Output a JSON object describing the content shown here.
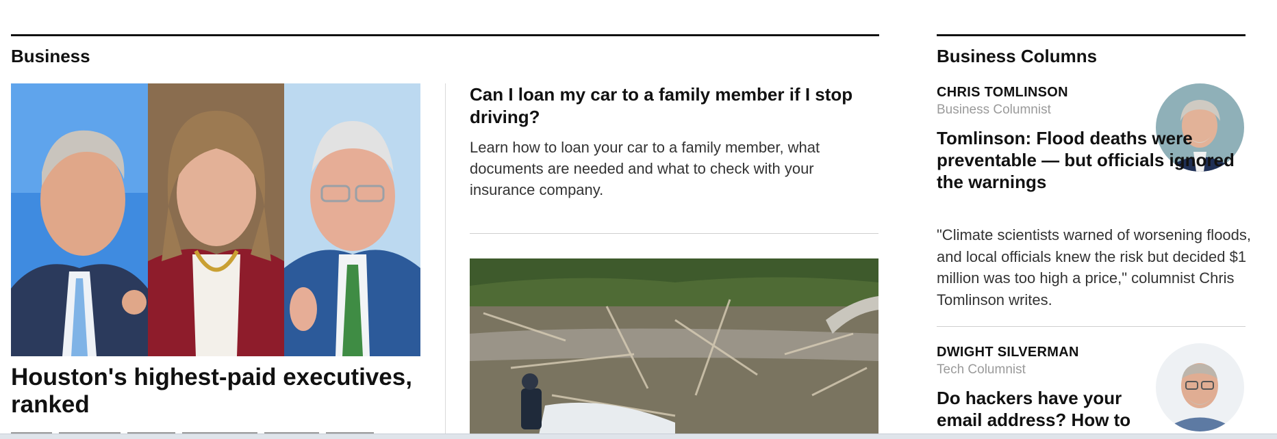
{
  "business": {
    "section_label": "Business",
    "lead_story": {
      "title": "Houston's highest-paid executives, ranked",
      "image_icon": "executive-portraits-photo"
    },
    "side_story": {
      "title": "Can I loan my car to a family member if I stop driving?",
      "dek": "Learn how to loan your car to a family member, what documents are needed and what to check with your insurance company."
    },
    "second_story": {
      "image_icon": "flood-damage-photo"
    }
  },
  "columns": {
    "section_label": "Business Columns",
    "items": [
      {
        "author": "CHRIS TOMLINSON",
        "role": "Business Columnist",
        "headline": "Tomlinson: Flood deaths were preventable — but officials ignored the warnings",
        "dek": "\"Climate scientists warned of worsening floods, and local officials knew the risk but decided $1 million was too high a price,\" columnist Chris Tomlinson writes.",
        "avatar_icon": "author-avatar"
      },
      {
        "author": "DWIGHT SILVERMAN",
        "role": "Tech Columnist",
        "headline": "Do hackers have your email address? How to",
        "avatar_icon": "author-avatar"
      }
    ]
  },
  "colors": {
    "text": "#111111",
    "muted": "#9a9a9a",
    "rule": "#111111",
    "divider": "#d9d9d9"
  }
}
